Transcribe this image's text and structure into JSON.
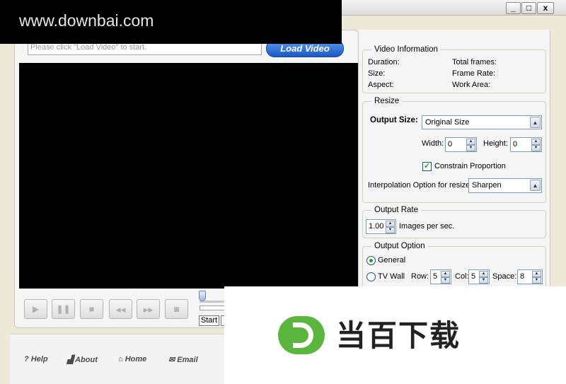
{
  "window": {
    "minimize": "_",
    "maximize": "□",
    "close": "x"
  },
  "watermark": "www.downbai.com",
  "load": {
    "placeholder": "Please click \"Load Video\" to start.",
    "button": "Load Video"
  },
  "controls": {
    "play_icon": "play-icon",
    "pause_icon": "pause-icon",
    "stop_icon": "stop-icon",
    "rewind_icon": "rewind-icon",
    "forward_icon": "fast-forward-icon",
    "snapshot_icon": "camera-icon",
    "play": "▶",
    "pause": "❚❚",
    "stop": "■",
    "rewind": "◀◀",
    "forward": "▶▶",
    "snapshot": "◙",
    "start_button": "Start"
  },
  "video_info": {
    "legend": "Video Information",
    "duration": "Duration:",
    "size": "Size:",
    "aspect": "Aspect:",
    "total_frames": "Total frames:",
    "frame_rate": "Frame Rate:",
    "work_area": "Work Area:"
  },
  "resize": {
    "legend": "Resize",
    "output_size_label": "Output Size:",
    "output_size_value": "Original Size",
    "width_label": "Width:",
    "width_value": "0",
    "height_label": "Height:",
    "height_value": "0",
    "constrain_label": "Constrain Proportion",
    "constrain_checked": true,
    "interp_label": "Interpolation Option for resize:",
    "interp_value": "Sharpen"
  },
  "output_rate": {
    "legend": "Output Rate",
    "value": "1.00",
    "unit": "Images per sec."
  },
  "output_option": {
    "legend": "Output Option",
    "general": "General",
    "tv_wall": "TV Wall",
    "selected": "General",
    "row_label": "Row:",
    "row_value": "5",
    "col_label": "Col:",
    "col_value": "5",
    "space_label": "Space:",
    "space_value": "8"
  },
  "footer": {
    "help": "? Help",
    "about": "About",
    "home": "Home",
    "email": "Email"
  },
  "brand": {
    "logo_letter": "D",
    "text": "当百下载",
    "color": "#5ab63c"
  }
}
